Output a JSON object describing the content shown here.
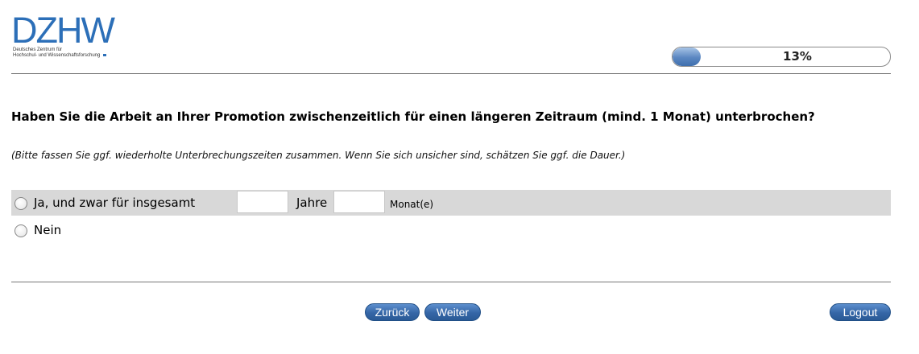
{
  "logo": {
    "mark": "DZHW",
    "line1": "Deutsches Zentrum für",
    "line2": "Hochschul- und Wissenschaftsforschung",
    "color": "#2c6fb8"
  },
  "progress": {
    "value": 13,
    "label": "13%"
  },
  "question": {
    "text": "Haben Sie die Arbeit an Ihrer Promotion zwischenzeitlich für einen längeren Zeitraum (mind. 1 Monat) unterbrochen?",
    "hint": "(Bitte fassen Sie ggf. wiederholte Unterbrechungszeiten zusammen. Wenn Sie sich unsicher sind, schätzen Sie ggf. die Dauer.)"
  },
  "options": {
    "ja": {
      "label": "Ja, und zwar für insgesamt",
      "years_value": "",
      "years_unit": "Jahre",
      "months_value": "",
      "months_unit": "Monat(e)"
    },
    "nein": {
      "label": "Nein"
    }
  },
  "buttons": {
    "back": "Zurück",
    "next": "Weiter",
    "logout": "Logout"
  },
  "colors": {
    "button": "#3566a6",
    "option_highlight": "#d8d8d8"
  }
}
